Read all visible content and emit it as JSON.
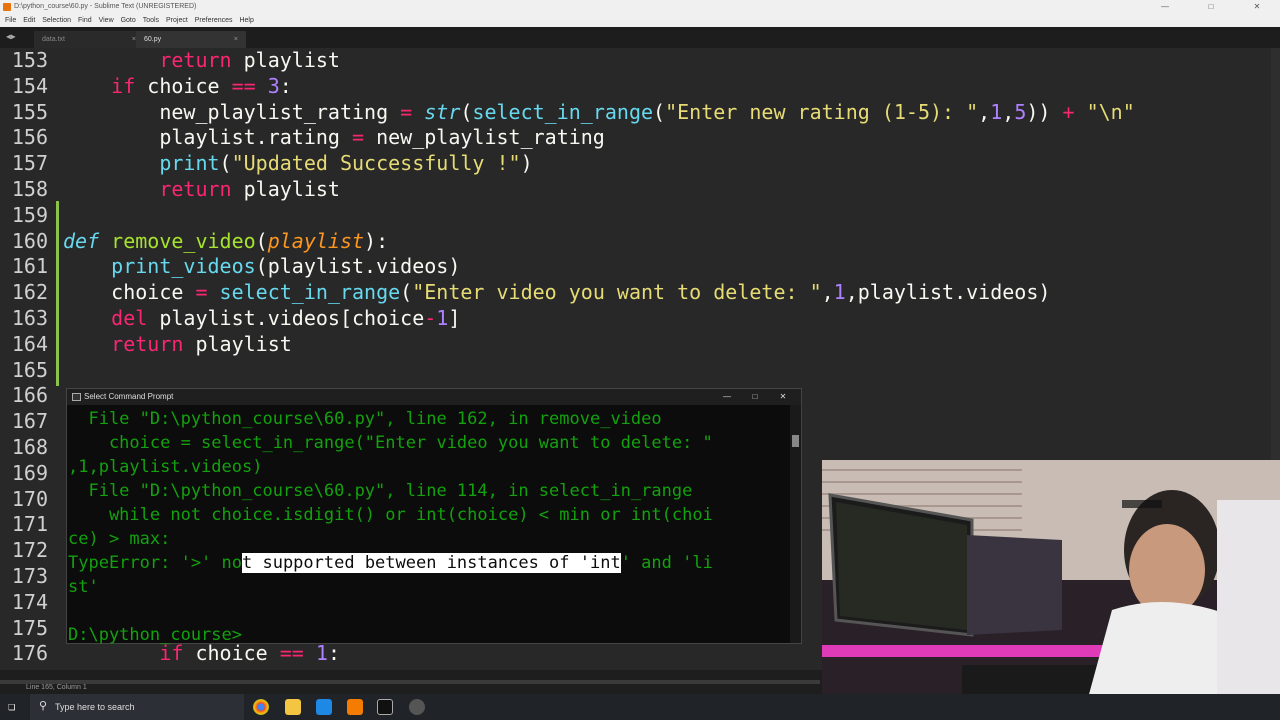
{
  "window": {
    "title": "D:\\python_course\\60.py - Sublime Text (UNREGISTERED)",
    "menu": [
      "File",
      "Edit",
      "Selection",
      "Find",
      "View",
      "Goto",
      "Tools",
      "Project",
      "Preferences",
      "Help"
    ]
  },
  "tabs": [
    {
      "label": "data.txt",
      "active": false
    },
    {
      "label": "60.py",
      "active": true
    }
  ],
  "editor": {
    "lines": [
      {
        "n": "153",
        "code": "        return playlist"
      },
      {
        "n": "154",
        "code": "    if choice == 3:"
      },
      {
        "n": "155",
        "code": "        new_playlist_rating = str(select_in_range(\"Enter new rating (1-5): \",1,5)) + \"\\n\""
      },
      {
        "n": "156",
        "code": "        playlist.rating = new_playlist_rating"
      },
      {
        "n": "157",
        "code": "        print(\"Updated Successfully !\")"
      },
      {
        "n": "158",
        "code": "        return playlist"
      },
      {
        "n": "159",
        "code": ""
      },
      {
        "n": "160",
        "code": "def remove_video(playlist):"
      },
      {
        "n": "161",
        "code": "    print_videos(playlist.videos)"
      },
      {
        "n": "162",
        "code": "    choice = select_in_range(\"Enter video you want to delete: \",1,playlist.videos)"
      },
      {
        "n": "163",
        "code": "    del playlist.videos[choice-1]"
      },
      {
        "n": "164",
        "code": "    return playlist"
      },
      {
        "n": "165",
        "code": ""
      },
      {
        "n": "166",
        "code": ""
      },
      {
        "n": "167",
        "code": ""
      },
      {
        "n": "168",
        "code": ""
      },
      {
        "n": "169",
        "code": ""
      },
      {
        "n": "170",
        "code": ""
      },
      {
        "n": "171",
        "code": ""
      },
      {
        "n": "172",
        "code": ""
      },
      {
        "n": "173",
        "code": ""
      },
      {
        "n": "174",
        "code": ""
      },
      {
        "n": "175",
        "code": ""
      },
      {
        "n": "176",
        "code": "        if choice == 1:"
      }
    ]
  },
  "status": {
    "text": "Line 165, Column 1"
  },
  "cmd": {
    "title": "Select Command Prompt",
    "lines": [
      "  File \"D:\\python_course\\60.py\", line 162, in remove_video",
      "    choice = select_in_range(\"Enter video you want to delete: \"",
      ",1,playlist.videos)",
      "  File \"D:\\python_course\\60.py\", line 114, in select_in_range",
      "    while not choice.isdigit() or int(choice) < min or int(choi",
      "ce) > max:",
      "TypeError: '>' no",
      "t supported between instances of 'int",
      "' and 'li",
      "st'",
      "",
      "D:\\python_course>"
    ]
  },
  "taskbar": {
    "search_placeholder": "Type here to search",
    "apps": [
      "chrome-icon",
      "file-explorer-icon",
      "mail-icon",
      "sublime-text-icon",
      "terminal-icon",
      "settings-icon"
    ]
  }
}
